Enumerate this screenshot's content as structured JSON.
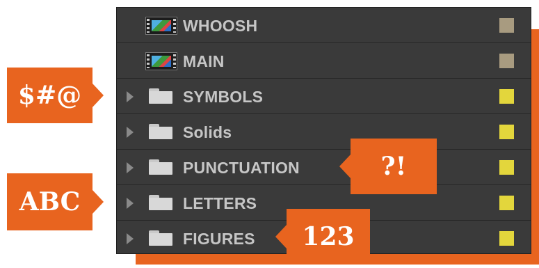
{
  "colors": {
    "accent": "#e8641f",
    "panel": "#3a3a3a",
    "comp_swatch": "#a89b80",
    "folder_swatch": "#e3d63c"
  },
  "layers": [
    {
      "name": "WHOOSH",
      "kind": "composition",
      "icon": "composition-icon",
      "expandable": false
    },
    {
      "name": "MAIN",
      "kind": "composition",
      "icon": "composition-icon",
      "expandable": false
    },
    {
      "name": "SYMBOLS",
      "kind": "folder",
      "icon": "folder-icon",
      "expandable": true
    },
    {
      "name": "Solids",
      "kind": "folder",
      "icon": "folder-icon",
      "expandable": true
    },
    {
      "name": "PUNCTUATION",
      "kind": "folder",
      "icon": "folder-icon",
      "expandable": true
    },
    {
      "name": "LETTERS",
      "kind": "folder",
      "icon": "folder-icon",
      "expandable": true
    },
    {
      "name": "FIGURES",
      "kind": "folder",
      "icon": "folder-icon",
      "expandable": true
    }
  ],
  "callouts": {
    "symbols": "$#@",
    "letters": "ABC",
    "punctuation": "?!",
    "figures": "123"
  }
}
